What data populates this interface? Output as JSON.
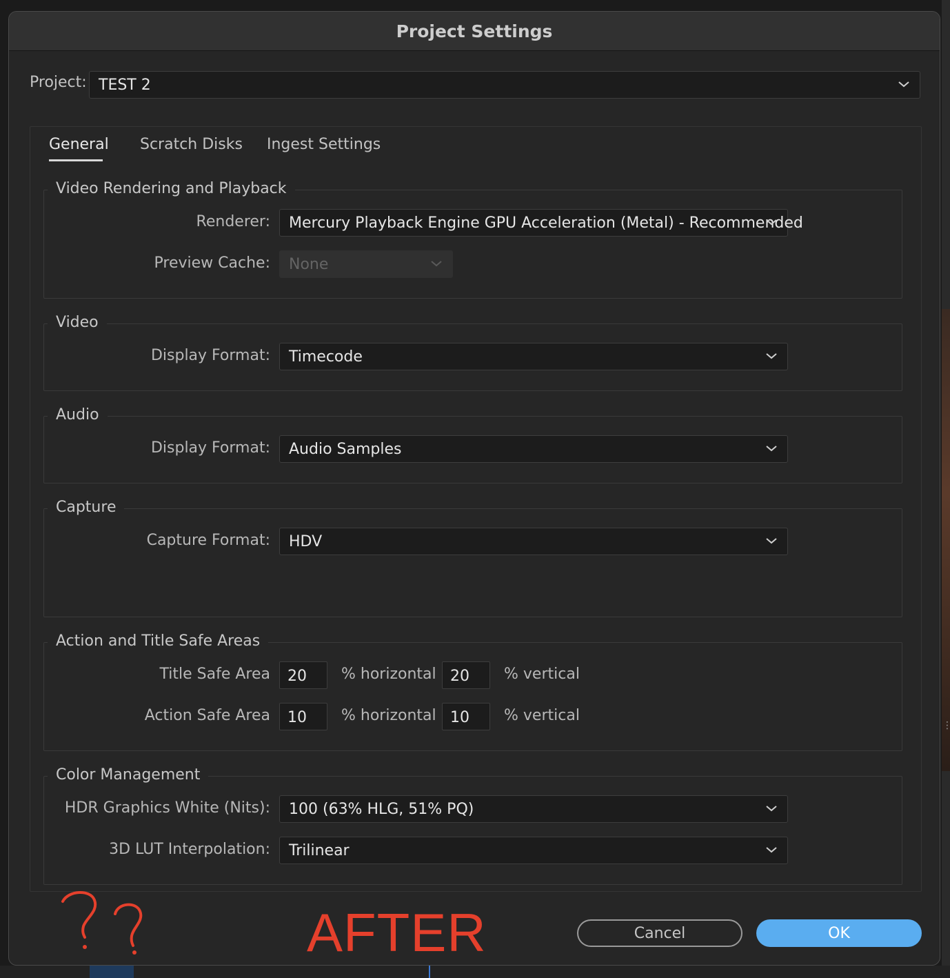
{
  "dialog": {
    "title": "Project Settings"
  },
  "project": {
    "label": "Project:",
    "value": "TEST 2"
  },
  "tabs": [
    {
      "label": "General",
      "active": true
    },
    {
      "label": "Scratch Disks",
      "active": false
    },
    {
      "label": "Ingest Settings",
      "active": false
    }
  ],
  "sections": {
    "rendering": {
      "title": "Video Rendering and Playback",
      "renderer_label": "Renderer:",
      "renderer_value": "Mercury Playback Engine GPU Acceleration (Metal) - Recommended",
      "preview_cache_label": "Preview Cache:",
      "preview_cache_value": "None"
    },
    "video": {
      "title": "Video",
      "display_format_label": "Display Format:",
      "display_format_value": "Timecode"
    },
    "audio": {
      "title": "Audio",
      "display_format_label": "Display Format:",
      "display_format_value": "Audio Samples"
    },
    "capture": {
      "title": "Capture",
      "capture_format_label": "Capture Format:",
      "capture_format_value": "HDV"
    },
    "safe_areas": {
      "title": "Action and Title Safe Areas",
      "title_safe_label": "Title Safe Area",
      "title_safe_h": "20",
      "title_safe_v": "20",
      "action_safe_label": "Action Safe Area",
      "action_safe_h": "10",
      "action_safe_v": "10",
      "horizontal_unit": "% horizontal",
      "vertical_unit": "% vertical"
    },
    "color": {
      "title": "Color Management",
      "hdr_label": "HDR Graphics White (Nits):",
      "hdr_value": "100 (63% HLG, 51% PQ)",
      "lut_label": "3D LUT Interpolation:",
      "lut_value": "Trilinear"
    }
  },
  "buttons": {
    "cancel": "Cancel",
    "ok": "OK"
  },
  "annotations": {
    "question_marks": "??",
    "after_text": "AFTER",
    "color": "#e5402c"
  },
  "colors": {
    "ok_button": "#5aadf0",
    "dialog_bg": "#262626"
  }
}
